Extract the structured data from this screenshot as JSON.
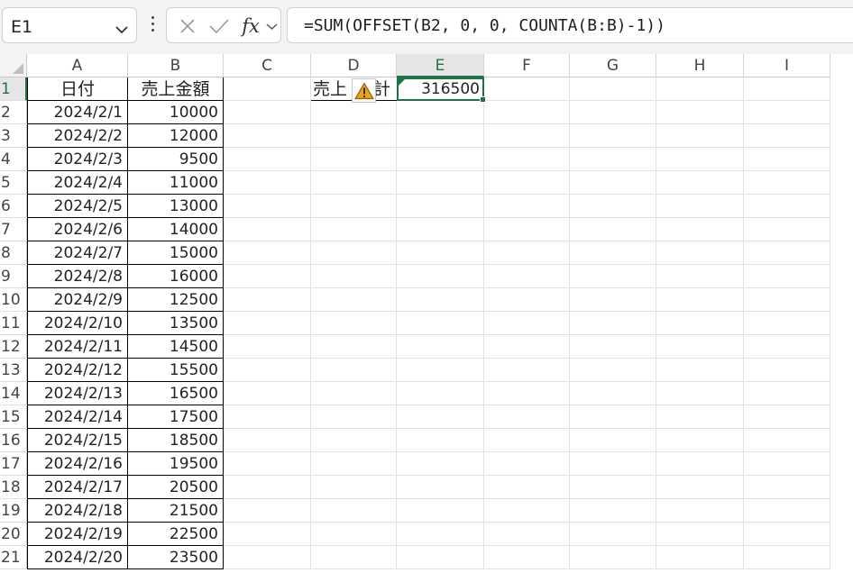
{
  "formula_bar": {
    "name_box": "E1",
    "formula": "=SUM(OFFSET(B2, 0, 0, COUNTA(B:B)-1))",
    "fx_label": "fx"
  },
  "columns": [
    "A",
    "B",
    "C",
    "D",
    "E",
    "F",
    "G",
    "H",
    "I"
  ],
  "selected_column": "E",
  "header_row": {
    "a": "日付",
    "b": "売上金額"
  },
  "summary": {
    "label_left": "売上",
    "label_right": "計",
    "value": "316500"
  },
  "rows": [
    {
      "n": "1"
    },
    {
      "n": "2",
      "date": "2024/2/1",
      "amount": "10000"
    },
    {
      "n": "3",
      "date": "2024/2/2",
      "amount": "12000"
    },
    {
      "n": "4",
      "date": "2024/2/3",
      "amount": "9500"
    },
    {
      "n": "5",
      "date": "2024/2/4",
      "amount": "11000"
    },
    {
      "n": "6",
      "date": "2024/2/5",
      "amount": "13000"
    },
    {
      "n": "7",
      "date": "2024/2/6",
      "amount": "14000"
    },
    {
      "n": "8",
      "date": "2024/2/7",
      "amount": "15000"
    },
    {
      "n": "9",
      "date": "2024/2/8",
      "amount": "16000"
    },
    {
      "n": "10",
      "date": "2024/2/9",
      "amount": "12500"
    },
    {
      "n": "11",
      "date": "2024/2/10",
      "amount": "13500"
    },
    {
      "n": "12",
      "date": "2024/2/11",
      "amount": "14500"
    },
    {
      "n": "13",
      "date": "2024/2/12",
      "amount": "15500"
    },
    {
      "n": "14",
      "date": "2024/2/13",
      "amount": "16500"
    },
    {
      "n": "15",
      "date": "2024/2/14",
      "amount": "17500"
    },
    {
      "n": "16",
      "date": "2024/2/15",
      "amount": "18500"
    },
    {
      "n": "17",
      "date": "2024/2/16",
      "amount": "19500"
    },
    {
      "n": "18",
      "date": "2024/2/17",
      "amount": "20500"
    },
    {
      "n": "19",
      "date": "2024/2/18",
      "amount": "21500"
    },
    {
      "n": "20",
      "date": "2024/2/19",
      "amount": "22500"
    },
    {
      "n": "21",
      "date": "2024/2/20",
      "amount": "23500"
    }
  ],
  "colors": {
    "accent": "#1f7246",
    "warning": "#e8a317"
  }
}
